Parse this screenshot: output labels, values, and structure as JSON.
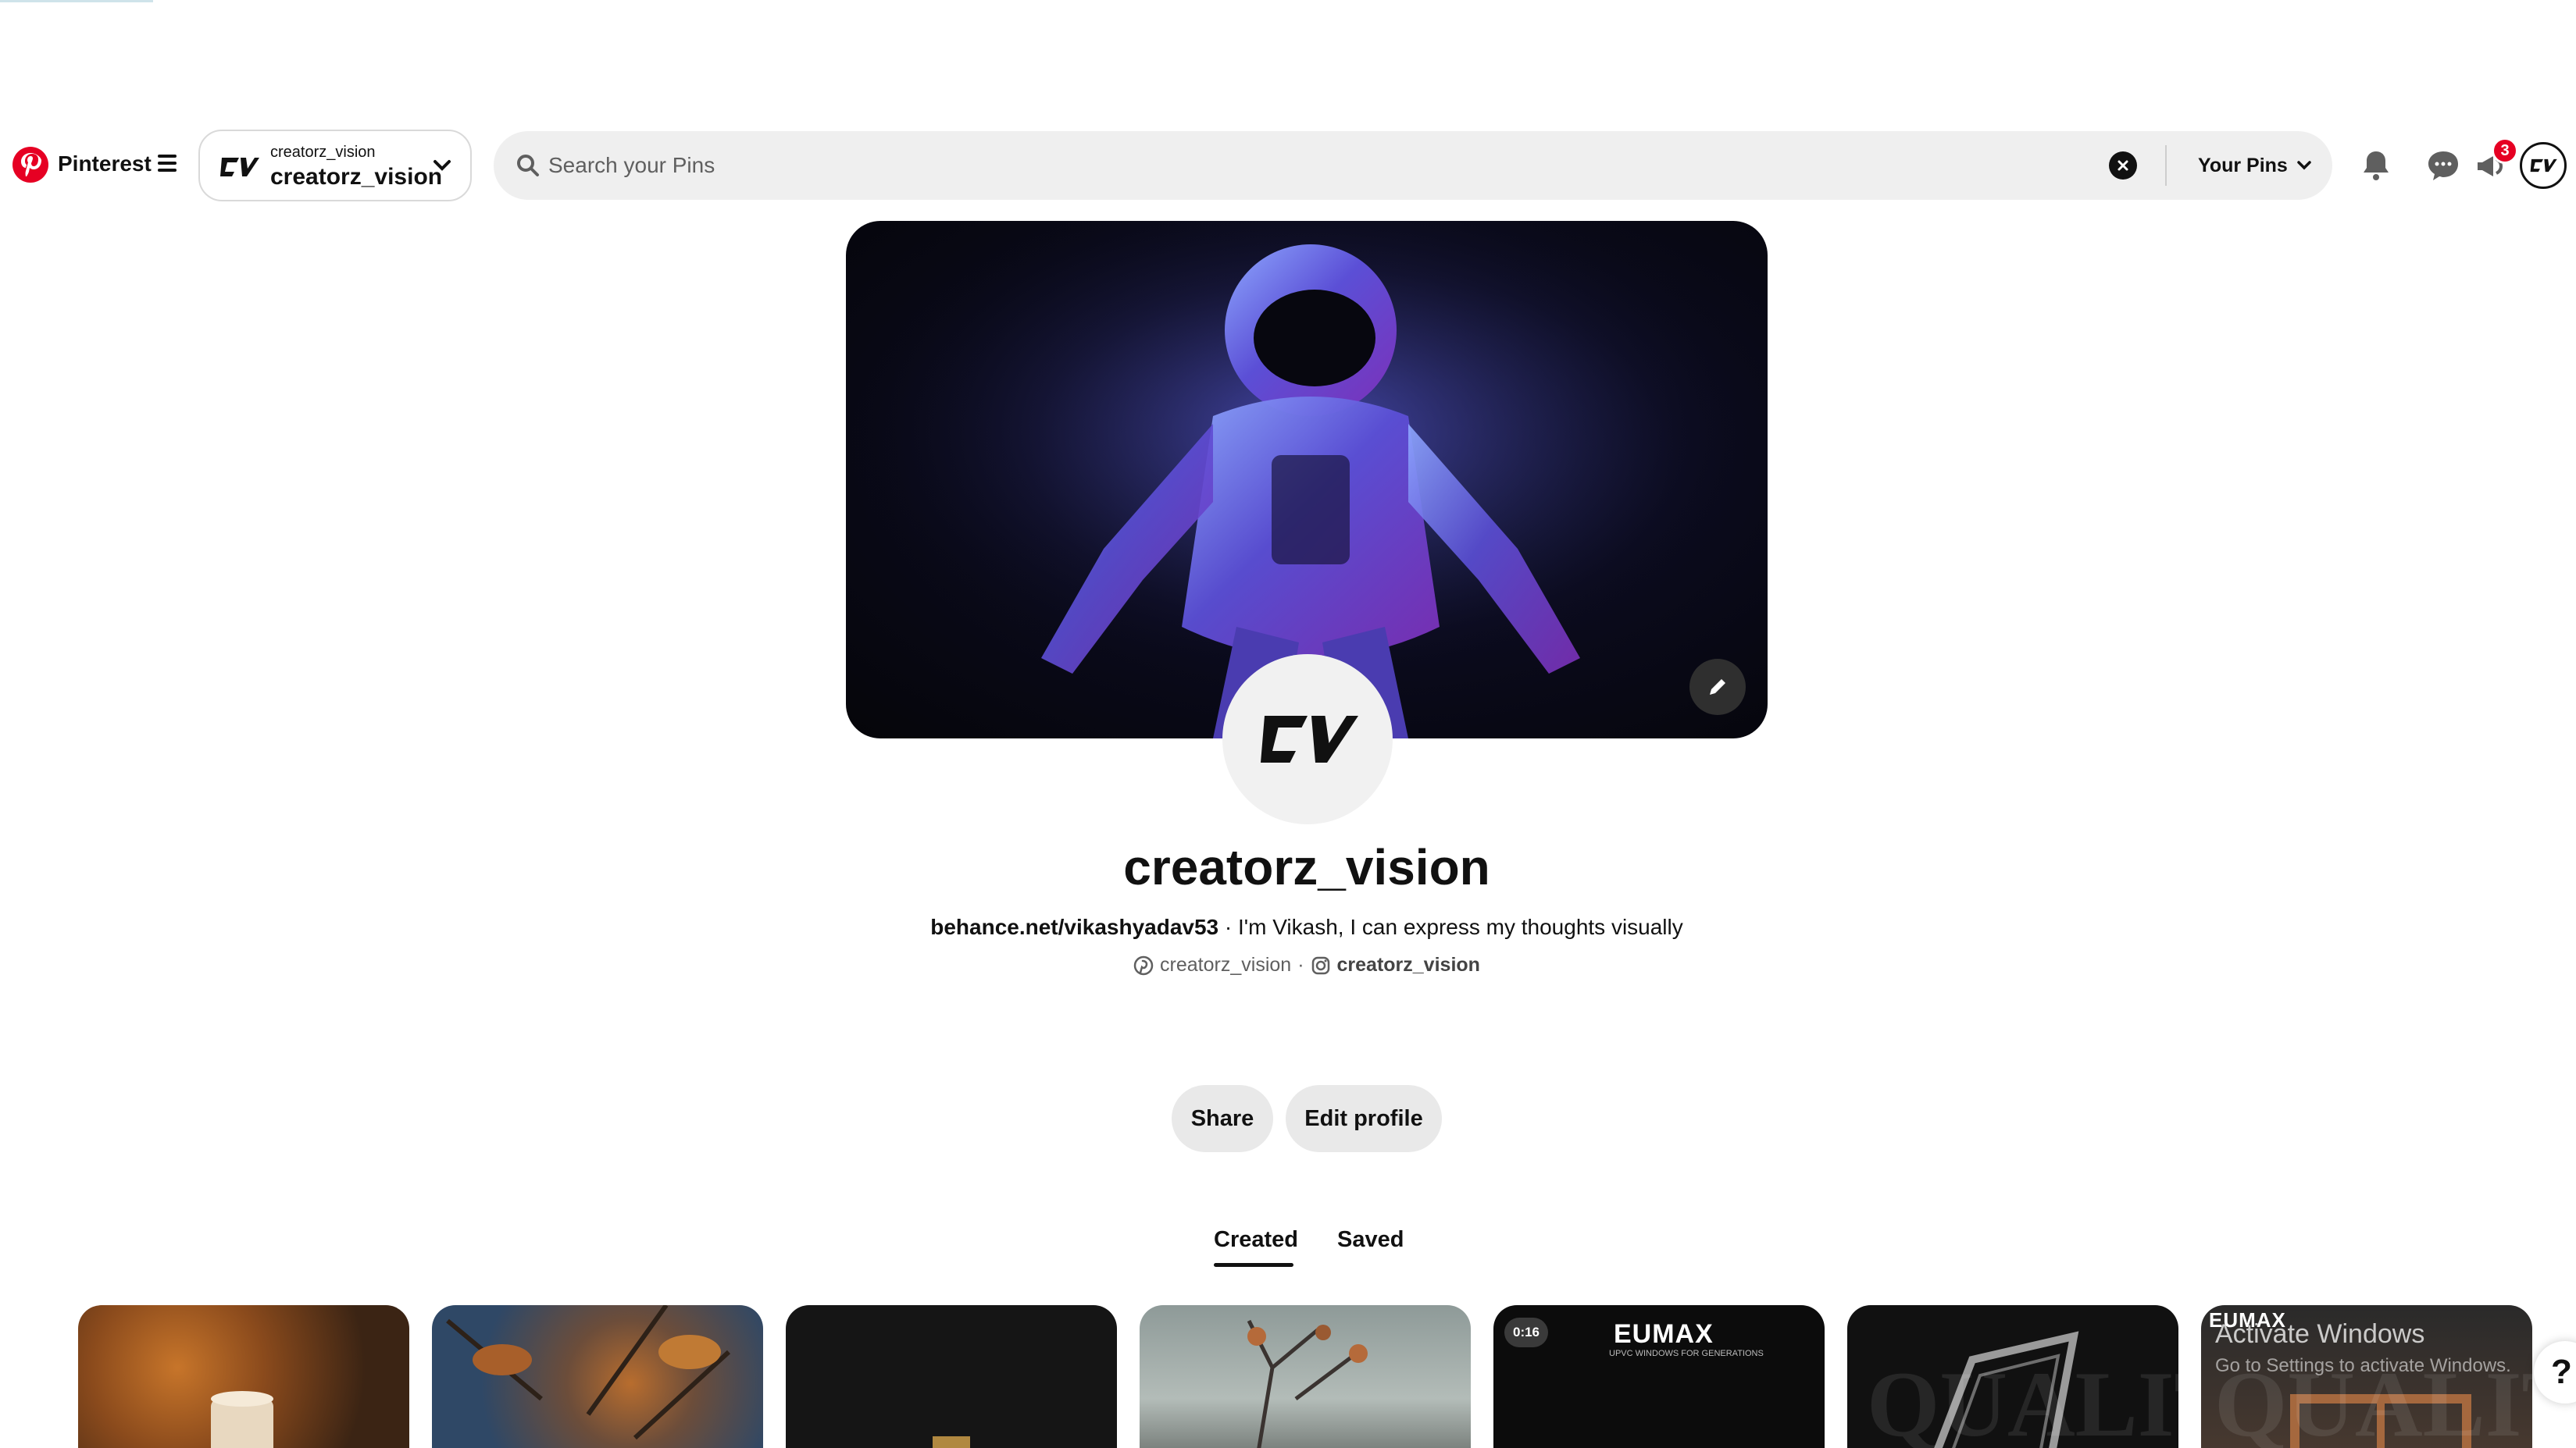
{
  "header": {
    "brand": "Pinterest",
    "account": {
      "small_name": "creatorz_vision",
      "name": "creatorz_vision"
    },
    "search": {
      "placeholder": "Search your Pins",
      "value": ""
    },
    "scope": "Your Pins",
    "notification_badge": "3"
  },
  "profile": {
    "name": "creatorz_vision",
    "bio_link": "behance.net/vikashyadav53",
    "bio_sep": " · ",
    "bio_text": "I'm Vikash, I can express my thoughts visually",
    "pinterest_handle": "creatorz_vision",
    "social_sep": "·",
    "instagram_handle": "creatorz_vision",
    "buttons": {
      "share": "Share",
      "edit": "Edit profile"
    }
  },
  "tabs": {
    "created": "Created",
    "saved": "Saved",
    "active": "Created"
  },
  "pins": {
    "video_duration": "0:16",
    "brand_5": "EUMAX",
    "tagline_5": "UPVC WINDOWS FOR GENERATIONS",
    "brand_7": "EUMAX",
    "ghost_6": "QUALITY",
    "ghost_7": "QUALITY"
  },
  "overlay": {
    "title": "Activate Windows",
    "subtitle": "Go to Settings to activate Windows."
  },
  "help": "?",
  "colors": {
    "brand_red": "#e60023",
    "button_gray": "#e9e9e9",
    "search_bg": "#efefef"
  }
}
